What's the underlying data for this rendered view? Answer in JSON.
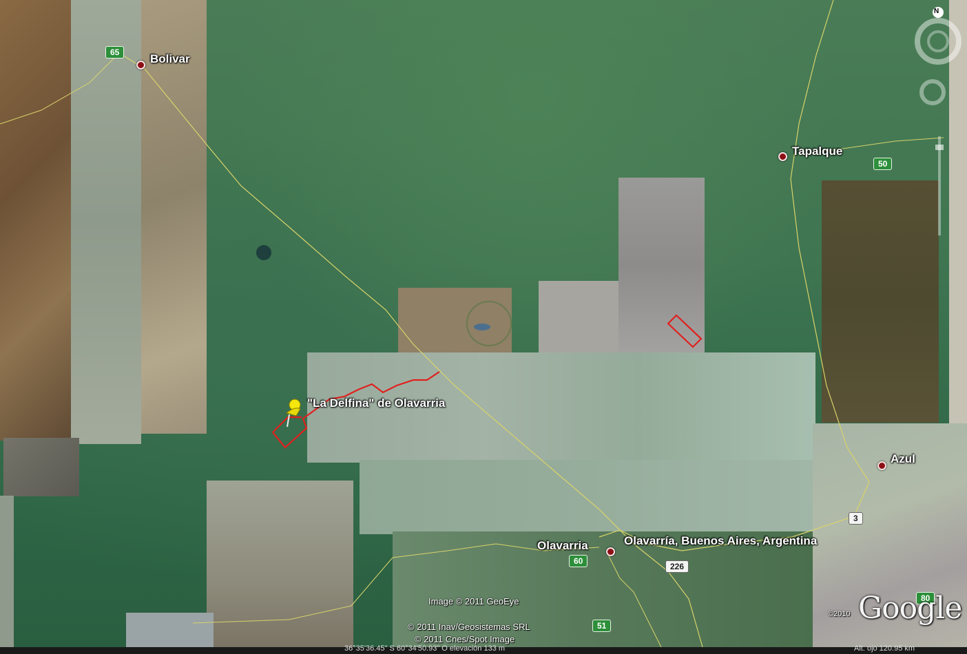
{
  "places": {
    "bolivar": "Bolivar",
    "tapalque": "Tapalque",
    "azul": "Azul",
    "olavarria": "Olavarria",
    "olavarria_full": "Olavarría, Buenos Aires, Argentina",
    "placemark": "\"La Delfina\" de Olavarria"
  },
  "routes": {
    "r65": "65",
    "r50": "50",
    "r3": "3",
    "r60": "60",
    "r226": "226",
    "r51": "51",
    "r80": "80"
  },
  "credits": {
    "geoeye": "Image © 2011 GeoEye",
    "inav": "© 2011 Inav/Geosistemas SRL",
    "cnes": "© 2011 Cnes/Spot Image",
    "year": "©2010",
    "logo": "Google"
  },
  "status": {
    "coords": "36°35'36.45\" S   60°34'50.93\" O   elevación  133 m",
    "altitude": "Alt. ojo  120.95 km"
  },
  "compass": {
    "north": "N"
  },
  "colors": {
    "placemark_outline": "#e0201e",
    "city_dot": "#8b0f14",
    "road": "#d9d36a"
  }
}
